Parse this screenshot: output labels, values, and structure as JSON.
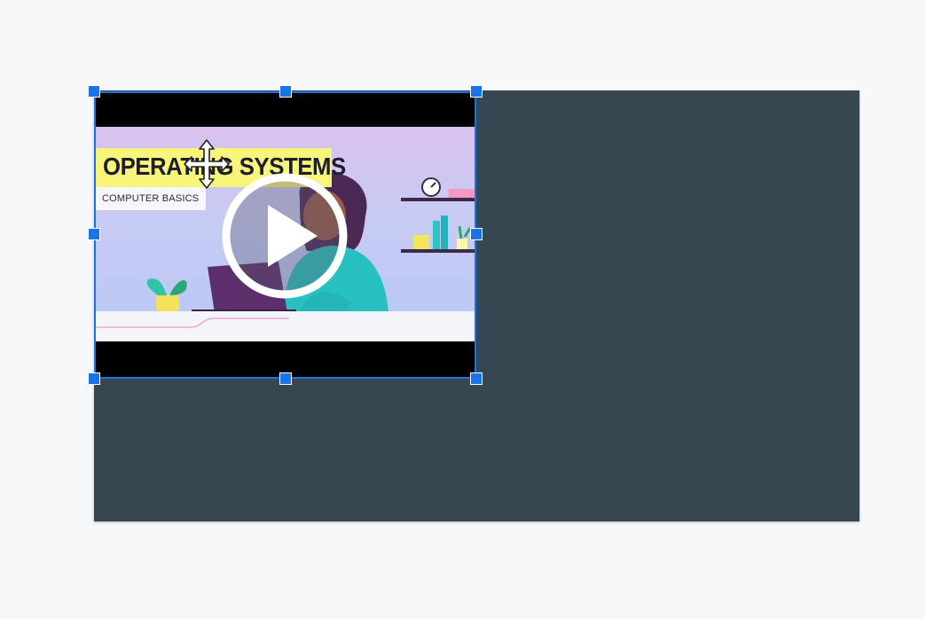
{
  "slide": {
    "background_color": "#37474f"
  },
  "video": {
    "title": "OPERATING SYSTEMS",
    "subtitle": "COMPUTER BASICS",
    "play_icon": "play-circle-icon",
    "accent_title_band": "#f7f57a"
  },
  "selection": {
    "color": "#1a73e8",
    "cursor_icon": "move-cursor-icon"
  }
}
